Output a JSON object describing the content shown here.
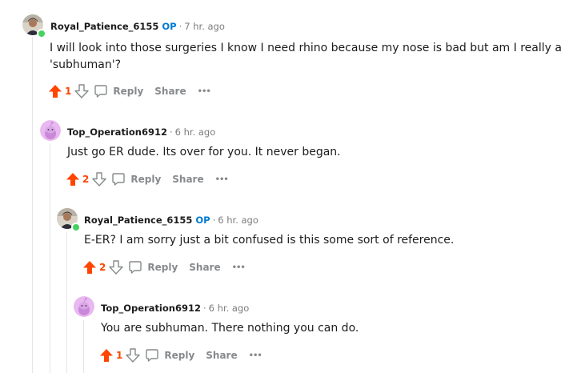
{
  "comments": [
    {
      "author": "Royal_Patience_6155",
      "op_label": "OP",
      "separator": "·",
      "time": "7 hr. ago",
      "body": "I will look into those surgeries I know I need rhino because my nose is bad but am I really a 'subhuman'?",
      "votes": "1",
      "reply_label": "Reply",
      "share_label": "Share",
      "more_label": "•••"
    },
    {
      "author": "Top_Operation6912",
      "separator": "·",
      "time": "6 hr. ago",
      "body": "Just go ER dude. Its over for you. It never began.",
      "votes": "2",
      "reply_label": "Reply",
      "share_label": "Share",
      "more_label": "•••"
    },
    {
      "author": "Royal_Patience_6155",
      "op_label": "OP",
      "separator": "·",
      "time": "6 hr. ago",
      "body": "E-ER? I am sorry just a bit confused is this some sort of reference.",
      "votes": "2",
      "reply_label": "Reply",
      "share_label": "Share",
      "more_label": "•••"
    },
    {
      "author": "Top_Operation6912",
      "separator": "·",
      "time": "6 hr. ago",
      "body": "You are subhuman. There nothing you can do.",
      "votes": "1",
      "reply_label": "Reply",
      "share_label": "Share",
      "more_label": "•••"
    }
  ],
  "colors": {
    "upvote": "#ff4500",
    "op": "#0079d3",
    "online": "#46d160",
    "muted": "#878a8c",
    "thread_line": "#e3e6e8"
  }
}
